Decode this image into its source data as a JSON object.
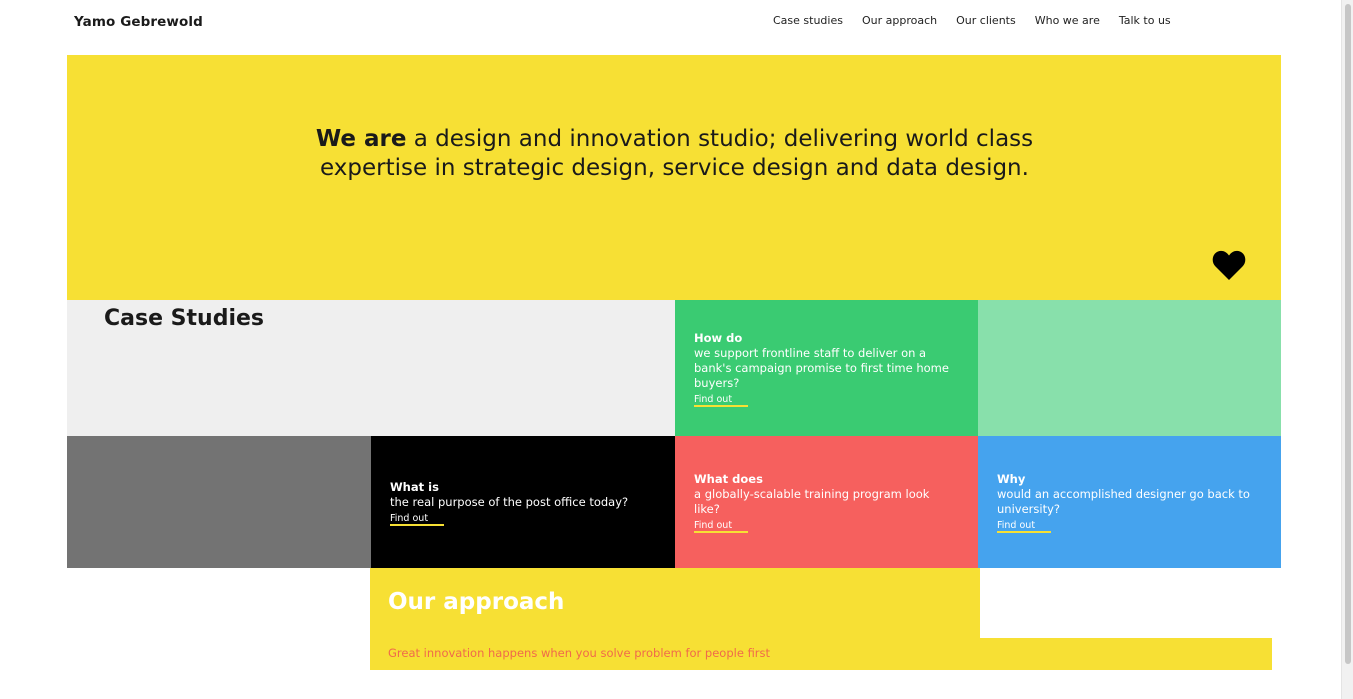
{
  "header": {
    "brand": "Yamo Gebrewold",
    "nav": [
      "Case studies",
      "Our approach",
      "Our clients",
      "Who we are",
      "Talk to us"
    ]
  },
  "hero": {
    "lead": "We are",
    "text": " a design and innovation studio; delivering world class expertise in strategic design, service design and data design.",
    "icon": "heart-icon"
  },
  "case_studies": {
    "title": "Case Studies",
    "cards": [
      {
        "kicker": "How do",
        "question": "we support frontline staff to deliver on a bank's campaign promise to first time home buyers?",
        "link": "Find out",
        "color": "#3acb72"
      },
      {
        "kicker": "What is",
        "question": "the real purpose of the post office today?",
        "link": "Find out",
        "color": "#000000"
      },
      {
        "kicker": "What does",
        "question": "a globally-scalable training program look like?",
        "link": "Find out",
        "color": "#f6605e"
      },
      {
        "kicker": "Why",
        "question": "would an accomplished designer go back to university?",
        "link": "Find out",
        "color": "#45a3ee"
      }
    ]
  },
  "approach": {
    "title": "Our approach",
    "subtitle": "Great innovation happens when you solve problem for people first"
  },
  "colors": {
    "yellow": "#f7e034",
    "light_gray": "#efefef",
    "dark_gray": "#737373",
    "green": "#3acb72",
    "light_green": "#88e0ab",
    "black": "#000000",
    "coral": "#f6605e",
    "blue": "#45a3ee"
  }
}
